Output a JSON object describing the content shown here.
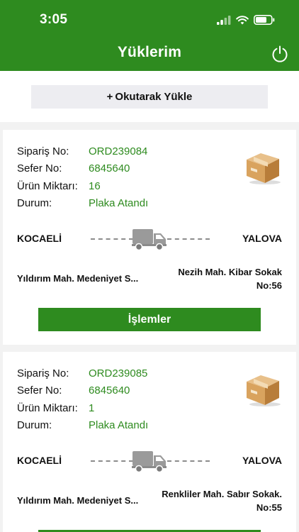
{
  "status_bar": {
    "time": "3:05"
  },
  "header": {
    "title": "Yüklerim",
    "power_icon": "power-icon"
  },
  "scan_button": {
    "plus": "+",
    "label": "Okutarak Yükle"
  },
  "labels": {
    "order_no": "Sipariş No:",
    "trip_no": "Sefer No:",
    "quantity": "Ürün Miktarı:",
    "status": "Durum:",
    "actions_button": "İşlemler"
  },
  "colors": {
    "brand_green": "#2e8b1f",
    "scan_button_bg": "#ededf1"
  },
  "orders": [
    {
      "order_no": "ORD239084",
      "trip_no": "6845640",
      "quantity": "16",
      "status": "Plaka Atandı",
      "from_city": "KOCAELİ",
      "to_city": "YALOVA",
      "from_address": "Yıldırım Mah. Medeniyet S...",
      "to_address_line1": "Nezih Mah. Kibar Sokak",
      "to_address_line2": "No:56"
    },
    {
      "order_no": "ORD239085",
      "trip_no": "6845640",
      "quantity": "1",
      "status": "Plaka Atandı",
      "from_city": "KOCAELİ",
      "to_city": "YALOVA",
      "from_address": "Yıldırım Mah. Medeniyet S...",
      "to_address_line1": "Renkliler Mah. Sabır Sokak.",
      "to_address_line2": "No:55"
    }
  ]
}
